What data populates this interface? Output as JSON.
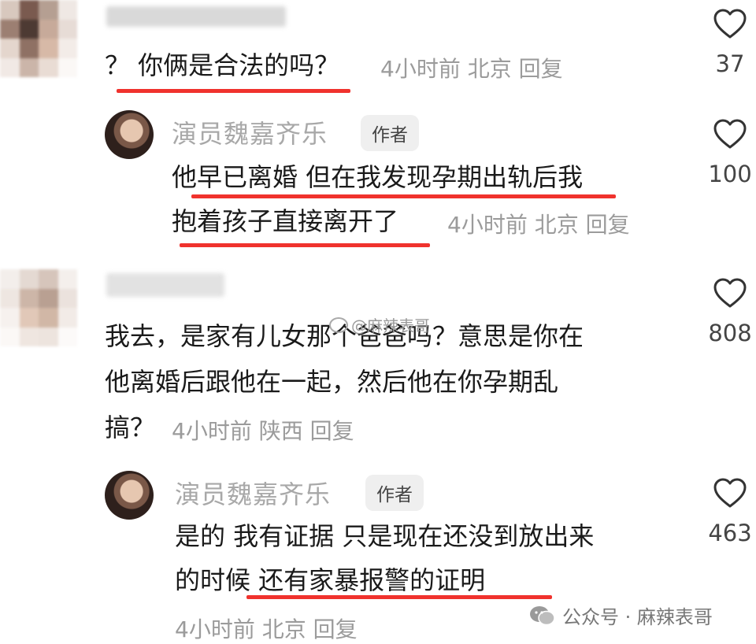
{
  "comments": [
    {
      "text_lines": [
        "？ 你俩是合法的吗？"
      ],
      "time": "4小时前",
      "location": "北京",
      "reply": "回复",
      "likes": "37"
    },
    {
      "author": "演员魏嘉齐乐",
      "author_tag": "作者",
      "text_lines": [
        "他早已离婚 但在我发现孕期出轨后我",
        "抱着孩子直接离开了"
      ],
      "time": "4小时前",
      "location": "北京",
      "reply": "回复",
      "likes": "100"
    },
    {
      "text_lines": [
        "我去，是家有儿女那个爸爸吗？意思是你在",
        "他离婚后跟他在一起，然后他在你孕期乱",
        "搞？"
      ],
      "time": "4小时前",
      "location": "陕西",
      "reply": "回复",
      "likes": "808"
    },
    {
      "author": "演员魏嘉齐乐",
      "author_tag": "作者",
      "text_lines": [
        "是的 我有证据 只是现在还没到放出来",
        "的时候 还有家暴报警的证明"
      ],
      "time": "4小时前",
      "location": "北京",
      "reply": "回复",
      "likes": "463"
    }
  ],
  "watermarks": {
    "center": "@麻辣表哥",
    "footer": "公众号 · 麻辣表哥"
  },
  "icons": {
    "like": "heart-outline-icon",
    "wechat": "wechat-icon",
    "weibo": "weibo-icon"
  },
  "colors": {
    "highlight_underline": "#f0322d",
    "meta_text": "#9b9b9b",
    "author_tag_bg": "#efefef"
  }
}
